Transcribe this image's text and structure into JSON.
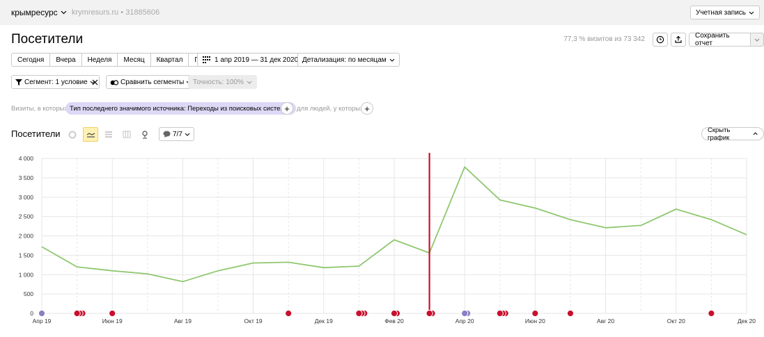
{
  "topbar": {
    "counter_name": "крымресурс",
    "counter_meta": "krymresurs.ru • 31885606",
    "account_label": "Учетная запись"
  },
  "header": {
    "title": "Посетители",
    "visits_share": "77,3 % визитов из 73 342",
    "save_label": "Сохранить отчет"
  },
  "period": {
    "buttons": [
      "Сегодня",
      "Вчера",
      "Неделя",
      "Месяц",
      "Квартал",
      "Год"
    ],
    "date_range": "1 апр 2019 — 31 дек 2020",
    "detail": "Детализация: по месяцам"
  },
  "segment": {
    "segment_label": "Сегмент: 1 условие",
    "compare_label": "Сравнить сегменты",
    "accuracy_label": "Точность: 100%"
  },
  "filters": {
    "visits_label": "Визиты, в которых",
    "condition": "Тип последнего значимого источника: Переходы из поисковых систем",
    "people_label": "для людей, у которых"
  },
  "chart_header": {
    "title": "Посетители",
    "notes_label": "7/7",
    "hide_label": "Скрыть график"
  },
  "colors": {
    "line": "#8fc76f",
    "marker_red": "#c8102e",
    "marker_purple": "#8a7fc2",
    "active_chart_type": "#fff1b3"
  },
  "chart_data": {
    "type": "line",
    "title": "",
    "xlabel": "",
    "ylabel": "",
    "x": [
      "Апр 19",
      "Май 19",
      "Июн 19",
      "Июл 19",
      "Авг 19",
      "Сен 19",
      "Окт 19",
      "Ноя 19",
      "Дек 19",
      "Янв 20",
      "Фев 20",
      "Мар 20",
      "Апр 20",
      "Май 20",
      "Июн 20",
      "Июл 20",
      "Авг 20",
      "Сен 20",
      "Окт 20",
      "Ноя 20",
      "Дек 20"
    ],
    "x_tick_labels": [
      "Апр 19",
      "Июн 19",
      "Авг 19",
      "Окт 19",
      "Дек 19",
      "Фев 20",
      "Апр 20",
      "Июн 20",
      "Авг 20",
      "Окт 20",
      "Дек 20"
    ],
    "series": [
      {
        "values": [
          1720,
          1200,
          1100,
          1020,
          820,
          1100,
          1300,
          1320,
          1180,
          1220,
          1900,
          1560,
          3780,
          2930,
          2720,
          2420,
          2210,
          2270,
          2690,
          2420,
          2030
        ]
      }
    ],
    "ylim": [
      0,
      4000
    ],
    "y_ticks": [
      0,
      500,
      1000,
      1500,
      2000,
      2500,
      3000,
      3500,
      4000
    ],
    "y_tick_labels": [
      "0",
      "500",
      "1 000",
      "1 500",
      "2 000",
      "2 500",
      "3 000",
      "3 500",
      "4 000"
    ],
    "grid": true,
    "vertical_marker_x": "Мар 20",
    "note_markers": [
      {
        "x": "Апр 19",
        "count": 1,
        "color": "purple"
      },
      {
        "x": "Май 19",
        "count": 3,
        "color": "red"
      },
      {
        "x": "Июн 19",
        "count": 1,
        "color": "red"
      },
      {
        "x": "Ноя 19",
        "count": 1,
        "color": "red"
      },
      {
        "x": "Янв 20",
        "count": 3,
        "color": "red"
      },
      {
        "x": "Фев 20",
        "count": 2,
        "color": "red"
      },
      {
        "x": "Мар 20",
        "count": 2,
        "color": "red"
      },
      {
        "x": "Апр 20",
        "count": 2,
        "color": "purple"
      },
      {
        "x": "Май 20",
        "count": 3,
        "color": "red"
      },
      {
        "x": "Июн 20",
        "count": 1,
        "color": "red"
      },
      {
        "x": "Июл 20",
        "count": 1,
        "color": "red"
      },
      {
        "x": "Ноя 20",
        "count": 1,
        "color": "red"
      }
    ]
  }
}
